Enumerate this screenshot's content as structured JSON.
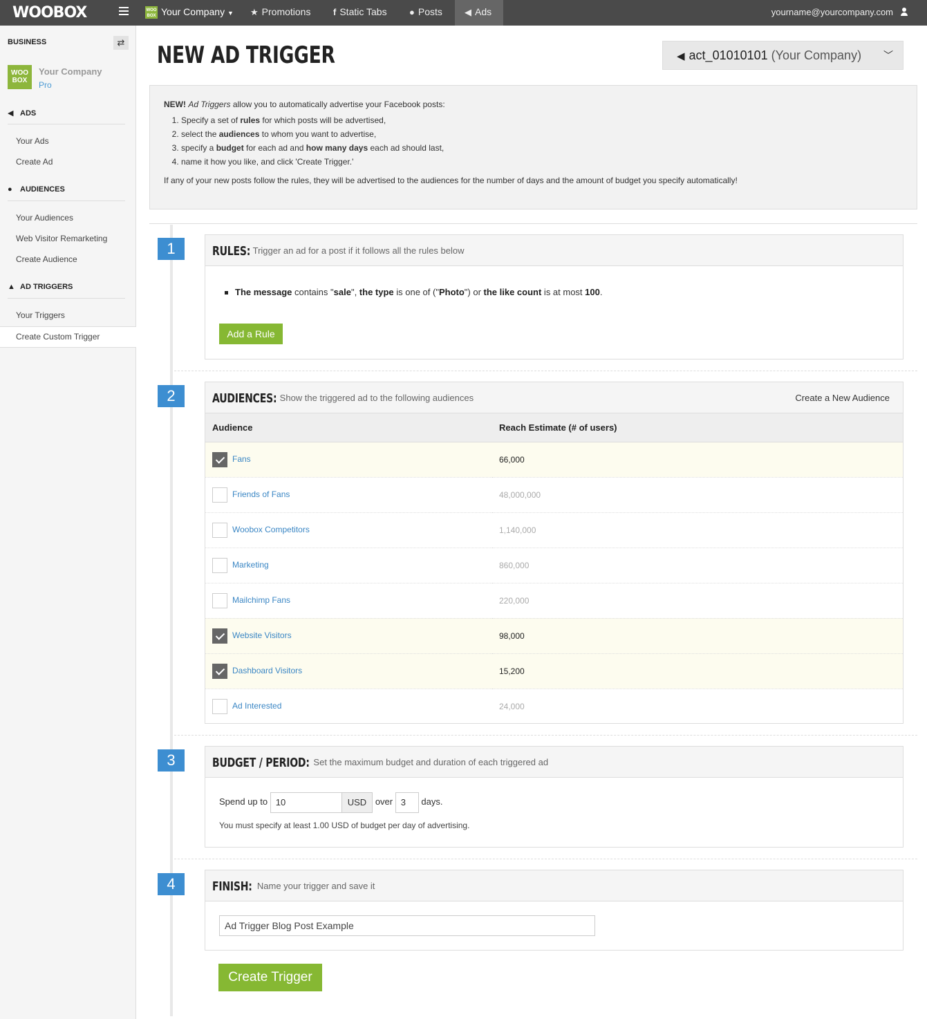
{
  "topnav": {
    "logo": "WOOBOX",
    "company": "Your Company",
    "promotions": "Promotions",
    "static_tabs": "Static Tabs",
    "posts": "Posts",
    "ads": "Ads",
    "user_email": "yourname@yourcompany.com"
  },
  "sidebar": {
    "business": "BUSINESS",
    "company": "Your Company",
    "plan": "Pro",
    "logo_text": "WOO BOX",
    "sections": [
      {
        "title": "ADS",
        "icon": "megaphone-icon",
        "items": [
          "Your Ads",
          "Create Ad"
        ]
      },
      {
        "title": "AUDIENCES",
        "icon": "user-icon",
        "items": [
          "Your Audiences",
          "Web Visitor Remarketing",
          "Create Audience"
        ]
      },
      {
        "title": "AD TRIGGERS",
        "icon": "flask-icon",
        "items": [
          "Your Triggers",
          "Create Custom Trigger"
        ]
      }
    ],
    "active_item": "Create Custom Trigger"
  },
  "page": {
    "title": "NEW AD TRIGGER",
    "account_id": "act_01010101",
    "account_name": "(Your Company)"
  },
  "intro": {
    "new_label": "NEW!",
    "feature_name": "Ad Triggers",
    "lead": "allow you to automatically advertise your Facebook posts:",
    "steps": [
      {
        "a": "Specify a set of ",
        "b": "rules",
        "c": " for which posts will be advertised,"
      },
      {
        "a": "select the ",
        "b": "audiences",
        "c": " to whom you want to advertise,"
      },
      {
        "a": "specify a ",
        "b": "budget",
        "c": " for each ad and ",
        "d": "how many days",
        "e": " each ad should last,"
      },
      {
        "a": "name it how you like, and click 'Create Trigger.'"
      }
    ],
    "footer": "If any of your new posts follow the rules, they will be advertised to the audiences for the number of days and the amount of budget you specify automatically!"
  },
  "steps": {
    "rules": {
      "number": "1",
      "label": "RULES:",
      "desc": "Trigger an ad for a post if it follows all the rules below",
      "rule": {
        "f1": "The message",
        "t1": " contains \"",
        "v1": "sale",
        "t2": "\", ",
        "f2": "the type",
        "t3": " is one of (\"",
        "v2": "Photo",
        "t4": "\") or ",
        "f3": "the like count",
        "t5": " is at most ",
        "v3": "100",
        "t6": "."
      },
      "add_button": "Add a Rule"
    },
    "audiences": {
      "number": "2",
      "label": "AUDIENCES:",
      "desc": "Show the triggered ad to the following audiences",
      "create_link": "Create a New Audience",
      "columns": [
        "Audience",
        "Reach Estimate (# of users)"
      ],
      "rows": [
        {
          "name": "Fans",
          "reach": "66,000",
          "checked": true
        },
        {
          "name": "Friends of Fans",
          "reach": "48,000,000",
          "checked": false
        },
        {
          "name": "Woobox Competitors",
          "reach": "1,140,000",
          "checked": false
        },
        {
          "name": "Marketing",
          "reach": "860,000",
          "checked": false
        },
        {
          "name": "Mailchimp Fans",
          "reach": "220,000",
          "checked": false
        },
        {
          "name": "Website Visitors",
          "reach": "98,000",
          "checked": true
        },
        {
          "name": "Dashboard Visitors",
          "reach": "15,200",
          "checked": true
        },
        {
          "name": "Ad Interested",
          "reach": "24,000",
          "checked": false
        }
      ]
    },
    "budget": {
      "number": "3",
      "label": "BUDGET / PERIOD:",
      "desc": "Set the maximum budget and duration of each triggered ad",
      "spend_label": "Spend up to",
      "amount": "10",
      "currency": "USD",
      "over_label": "over",
      "days": "3",
      "days_label": "days.",
      "note": "You must specify at least 1.00 USD of budget per day of advertising."
    },
    "finish": {
      "number": "4",
      "label": "FINISH:",
      "desc": "Name your trigger and save it",
      "name_value": "Ad Trigger Blog Post Example",
      "create_button": "Create Trigger"
    }
  }
}
